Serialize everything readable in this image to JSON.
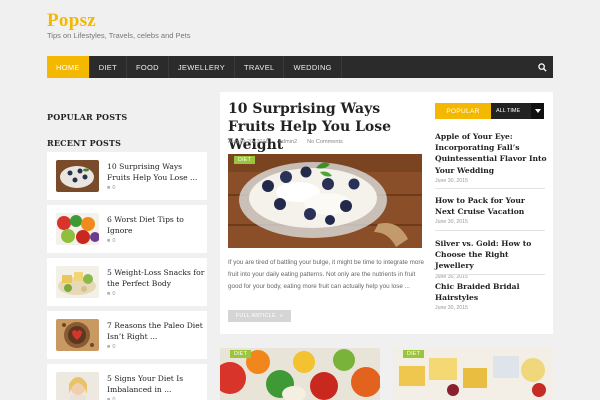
{
  "site": {
    "title": "Popsz",
    "tagline": "Tips on Lifestyles, Travels, celebs and Pets"
  },
  "nav": {
    "items": [
      "HOME",
      "DIET",
      "FOOD",
      "JEWELLERY",
      "TRAVEL",
      "WEDDING"
    ],
    "active": "HOME",
    "search_icon": "search-icon"
  },
  "sidebar": {
    "popular_heading": "POPULAR POSTS",
    "recent_heading": "RECENT POSTS",
    "recent_posts": [
      {
        "title": "10 Surprising Ways Fruits Help You Lose ...",
        "comments": "0"
      },
      {
        "title": "6 Worst Diet Tips to Ignore",
        "comments": "0"
      },
      {
        "title": "5 Weight-Loss Snacks for the Perfect Body",
        "comments": "0"
      },
      {
        "title": "7 Reasons the Paleo Diet Isn’t Right ...",
        "comments": "0"
      },
      {
        "title": "5 Signs Your Diet Is Imbalanced in ...",
        "comments": "0"
      }
    ]
  },
  "article": {
    "title": "10 Surprising Ways Fruits Help You Lose Weight",
    "date": "August 20, 2015",
    "author": "admin2",
    "comments": "No Comments",
    "category": "DIET",
    "excerpt": "If you are tired of battling your bulge, it might be time to integrate more fruit into your daily eating patterns. Not only are the nutrients in fruit good for your body, eating more fruit can actually help you lose ...",
    "button_label": "FULL ARTICLE",
    "button_arrow": "»"
  },
  "popular_box": {
    "tab_popular": "POPULAR",
    "tab_alltime": "ALL TIME",
    "items": [
      {
        "title": "Apple of Your Eye: Incorporating Fall’s Quintessential Flavor Into Your Wedding",
        "date": "June 30, 2015"
      },
      {
        "title": "How to Pack for Your Next Cruise Vacation",
        "date": "June 30, 2015"
      },
      {
        "title": "Silver vs. Gold: How to Choose the Right Jewellery",
        "date": "June 30, 2015"
      },
      {
        "title": "Chic Braided Bridal Hairstyles",
        "date": "June 30, 2015"
      }
    ]
  },
  "bottom_cards": [
    {
      "category": "DIET"
    },
    {
      "category": "DIET"
    }
  ],
  "colors": {
    "accent": "#f5b800",
    "nav_bg": "#2b2b2b",
    "badge": "#9bc53d"
  }
}
